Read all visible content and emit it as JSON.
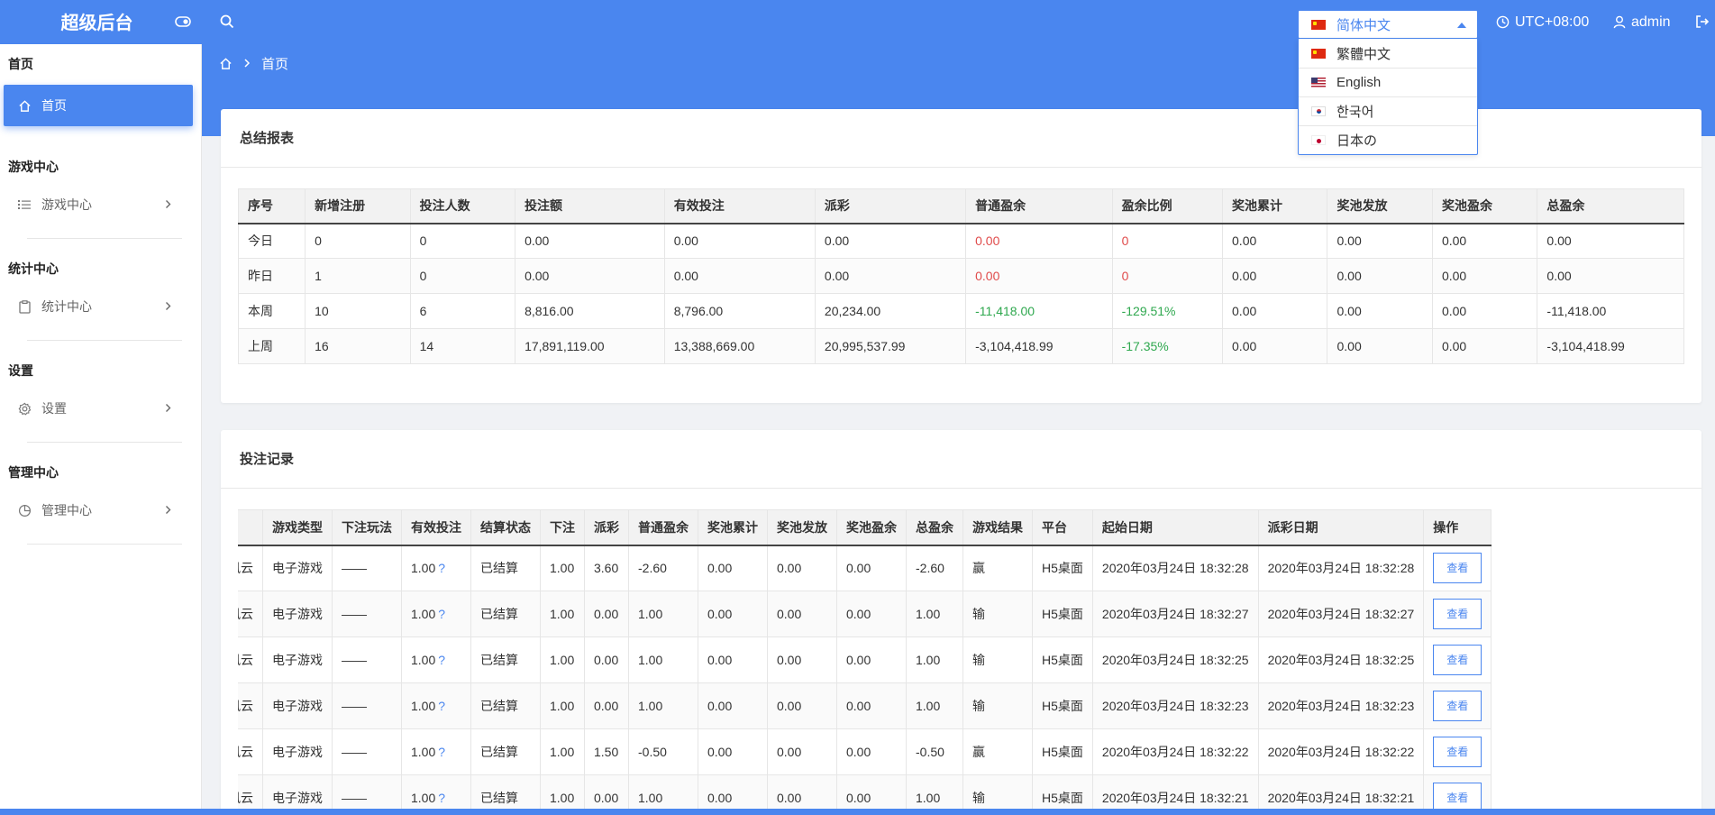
{
  "header": {
    "brand": "超级后台",
    "timezone": "UTC+08:00",
    "user": "admin",
    "accent_color": "#4a86ef",
    "icons": [
      "toggle-icon",
      "search-icon",
      "clock-icon",
      "user-icon",
      "logout-icon"
    ]
  },
  "language": {
    "selected": "简体中文",
    "options": [
      {
        "label": "繁體中文",
        "flag": "cn"
      },
      {
        "label": "English",
        "flag": "us"
      },
      {
        "label": "한국어",
        "flag": "kr"
      },
      {
        "label": "日本の",
        "flag": "jp"
      }
    ]
  },
  "breadcrumb": {
    "home": "首页"
  },
  "sidebar": {
    "groups": [
      {
        "title": "首页",
        "item": "首页",
        "icon": "home-icon",
        "active": true
      },
      {
        "title": "游戏中心",
        "item": "游戏中心",
        "icon": "list-icon",
        "active": false
      },
      {
        "title": "统计中心",
        "item": "统计中心",
        "icon": "clipboard-icon",
        "active": false
      },
      {
        "title": "设置",
        "item": "设置",
        "icon": "gear-icon",
        "active": false
      },
      {
        "title": "管理中心",
        "item": "管理中心",
        "icon": "pie-chart-icon",
        "active": false
      }
    ]
  },
  "summary": {
    "title": "总结报表",
    "columns": [
      "序号",
      "新增注册",
      "投注人数",
      "投注额",
      "有效投注",
      "派彩",
      "普通盈余",
      "盈余比例",
      "奖池累计",
      "奖池发放",
      "奖池盈余",
      "总盈余"
    ],
    "rows": [
      {
        "cells": [
          "今日",
          "0",
          "0",
          "0.00",
          "0.00",
          "0.00",
          "0.00",
          "0",
          "0.00",
          "0.00",
          "0.00",
          "0.00"
        ],
        "surplus_color": "red"
      },
      {
        "cells": [
          "昨日",
          "1",
          "0",
          "0.00",
          "0.00",
          "0.00",
          "0.00",
          "0",
          "0.00",
          "0.00",
          "0.00",
          "0.00"
        ],
        "surplus_color": "red"
      },
      {
        "cells": [
          "本周",
          "10",
          "6",
          "8,816.00",
          "8,796.00",
          "20,234.00",
          "-11,418.00",
          "-129.51%",
          "0.00",
          "0.00",
          "0.00",
          "-11,418.00"
        ],
        "surplus_color": "green"
      },
      {
        "cells": [
          "上周",
          "16",
          "14",
          "17,891,119.00",
          "13,388,669.00",
          "20,995,537.99",
          "-3,104,418.99",
          "-17.35%",
          "0.00",
          "0.00",
          "0.00",
          "-3,104,418.99"
        ],
        "surplus_color": "mixed"
      }
    ]
  },
  "bets": {
    "title": "投注记录",
    "columns": [
      "",
      "游戏类型",
      "下注玩法",
      "有效投注",
      "结算状态",
      "下注",
      "派彩",
      "普通盈余",
      "奖池累计",
      "奖池发放",
      "奖池盈余",
      "总盈余",
      "游戏结果",
      "平台",
      "起始日期",
      "派彩日期",
      "操作"
    ],
    "view_label": "查看",
    "help_mark": "?",
    "rows": [
      [
        "风云",
        "电子游戏",
        "——",
        "1.00",
        "已结算",
        "1.00",
        "3.60",
        "-2.60",
        "0.00",
        "0.00",
        "0.00",
        "-2.60",
        "赢",
        "H5桌面",
        "2020年03月24日 18:32:28",
        "2020年03月24日 18:32:28"
      ],
      [
        "风云",
        "电子游戏",
        "——",
        "1.00",
        "已结算",
        "1.00",
        "0.00",
        "1.00",
        "0.00",
        "0.00",
        "0.00",
        "1.00",
        "输",
        "H5桌面",
        "2020年03月24日 18:32:27",
        "2020年03月24日 18:32:27"
      ],
      [
        "风云",
        "电子游戏",
        "——",
        "1.00",
        "已结算",
        "1.00",
        "0.00",
        "1.00",
        "0.00",
        "0.00",
        "0.00",
        "1.00",
        "输",
        "H5桌面",
        "2020年03月24日 18:32:25",
        "2020年03月24日 18:32:25"
      ],
      [
        "风云",
        "电子游戏",
        "——",
        "1.00",
        "已结算",
        "1.00",
        "0.00",
        "1.00",
        "0.00",
        "0.00",
        "0.00",
        "1.00",
        "输",
        "H5桌面",
        "2020年03月24日 18:32:23",
        "2020年03月24日 18:32:23"
      ],
      [
        "风云",
        "电子游戏",
        "——",
        "1.00",
        "已结算",
        "1.00",
        "1.50",
        "-0.50",
        "0.00",
        "0.00",
        "0.00",
        "-0.50",
        "赢",
        "H5桌面",
        "2020年03月24日 18:32:22",
        "2020年03月24日 18:32:22"
      ],
      [
        "风云",
        "电子游戏",
        "——",
        "1.00",
        "已结算",
        "1.00",
        "0.00",
        "1.00",
        "0.00",
        "0.00",
        "0.00",
        "1.00",
        "输",
        "H5桌面",
        "2020年03月24日 18:32:21",
        "2020年03月24日 18:32:21"
      ]
    ]
  }
}
